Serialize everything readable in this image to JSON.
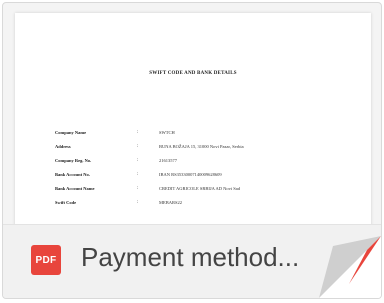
{
  "document": {
    "title": "SWIFT CODE AND BANK DETAILS",
    "rows": [
      {
        "label": "Company Name",
        "value": "SWTCH"
      },
      {
        "label": "Address",
        "value": "BUNA BOŽAJA 15, 31000 Novi Pazar, Serbia"
      },
      {
        "label": "Company Reg. No.",
        "value": "21613577"
      },
      {
        "label": "Bank Account No.",
        "value": "IBAN RS35330007140009628609"
      },
      {
        "label": "Bank Account Name",
        "value": "CREDIT AGRICOLE SRBIJA AD Novi Sad"
      },
      {
        "label": "Swift Code",
        "value": "MEBARS22"
      }
    ]
  },
  "file": {
    "type_badge": "PDF",
    "name": "Payment method..."
  },
  "icons": {
    "file_type": "pdf-icon",
    "corner": "page-curl-icon"
  },
  "colors": {
    "pdf_red": "#e8453c",
    "corner_gray": "#cfcfcf"
  }
}
